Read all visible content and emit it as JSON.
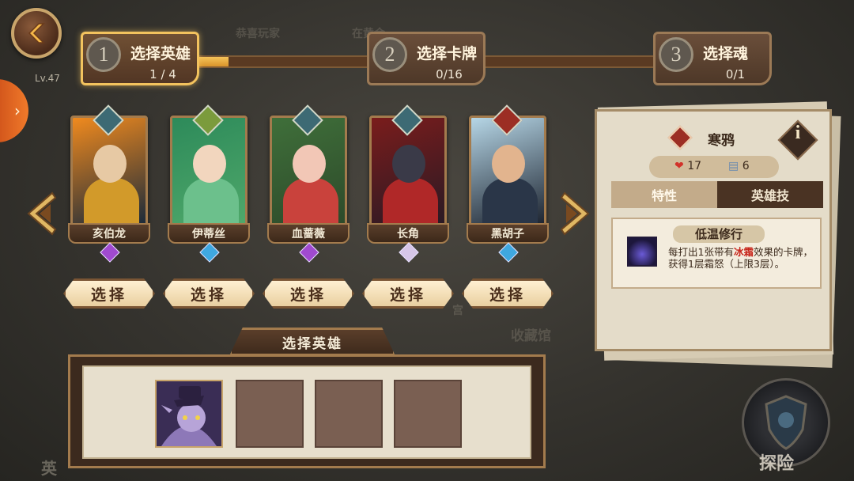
{
  "back_button": {
    "icon": "back-chevron-icon"
  },
  "player": {
    "level": "Lv.47"
  },
  "background": {
    "ghost_texts": [
      "恭喜玩家",
      "在黄金",
      "宫",
      "收藏馆",
      "英"
    ],
    "adventure_label": "探险"
  },
  "steps": [
    {
      "num": "1",
      "title": "选择英雄",
      "count": "1 / 4",
      "active": true
    },
    {
      "num": "2",
      "title": "选择卡牌",
      "count": "0/16",
      "active": false
    },
    {
      "num": "3",
      "title": "选择魂",
      "count": "0/1",
      "active": false
    }
  ],
  "step_progress": 0.15,
  "heroes": [
    {
      "name": "亥伯龙",
      "class_color": "#3d6a74",
      "gem_color": "#a04ad0",
      "art": [
        "#f08a1e",
        "#1b2a3a",
        "#e7c9a4",
        "#d29a2a"
      ],
      "select_label": "选择"
    },
    {
      "name": "伊蒂丝",
      "class_color": "#7b9b3c",
      "gem_color": "#3fa8e0",
      "art": [
        "#2d8a5a",
        "#4fa86a",
        "#f2d6be",
        "#6cc08c"
      ],
      "select_label": "选择"
    },
    {
      "name": "血蔷薇",
      "class_color": "#3d6a74",
      "gem_color": "#a04ad0",
      "art": [
        "#3f6f3a",
        "#2d4a2a",
        "#f2c7b6",
        "#c9423c"
      ],
      "select_label": "选择"
    },
    {
      "name": "长角",
      "class_color": "#3d6a74",
      "gem_color": "#d6c6e8",
      "art": [
        "#7a1c1c",
        "#2a1a24",
        "#3a3a48",
        "#b02828"
      ],
      "select_label": "选择"
    },
    {
      "name": "黑胡子",
      "class_color": "#9c2e24",
      "gem_color": "#3fa8e0",
      "art": [
        "#b6d6e6",
        "#1d2430",
        "#e2b48e",
        "#2a3648"
      ],
      "select_label": "选择"
    }
  ],
  "detail": {
    "hero_name": "寒鸦",
    "class_icon": "sword-class-icon",
    "hp": "17",
    "cards": "6",
    "tabs": [
      "特性",
      "英雄技"
    ],
    "active_tab": 0,
    "trait_title": "低温修行",
    "trait_desc_pre": "每打出1张带有",
    "trait_desc_hl": "冰霜",
    "trait_desc_post": "效果的卡牌，获得1层霜怒（上限3层）。"
  },
  "team": {
    "header": "选择英雄",
    "slots": [
      {
        "filled": true
      },
      {
        "filled": false
      },
      {
        "filled": false
      },
      {
        "filled": false
      }
    ]
  }
}
